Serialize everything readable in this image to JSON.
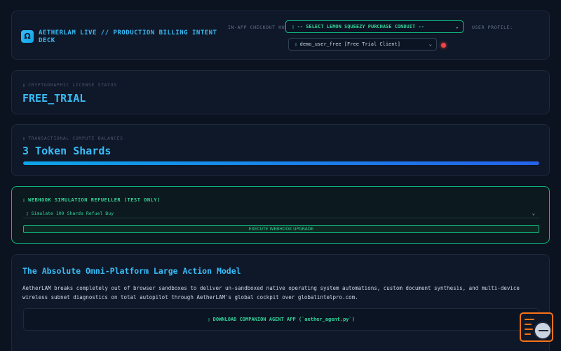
{
  "header": {
    "logo_letter": "Ω",
    "title": "AETHERLAM LIVE // PRODUCTION BILLING INTENT DECK",
    "hub_label": "IN-APP CHECKOUT HUB:",
    "hub_select": "-- SELECT LEMON SQUEEZY PURCHASE CONDUIT --",
    "profile_label": "USER PROFILE:",
    "user_select": "demo_user_free [Free Trial Client]"
  },
  "license": {
    "label": "CRYPTOGRAPHIC LICENSE STATUS",
    "value": "FREE_TRIAL"
  },
  "balance": {
    "label": "TRANSACTIONAL COMPUTE BALANCES",
    "value": "3 Token Shards",
    "progress_percent": 100
  },
  "webhook": {
    "title": "WEBHOOK SIMULATION REFUELLER (TEST ONLY)",
    "select_value": "Simulate 100 Shards Refuel Buy",
    "button_label": "EXECUTE WEBHOOK UPGRADE"
  },
  "hero": {
    "title": "The Absolute Omni-Platform Large Action Model",
    "description": "AetherLAM breaks completely out of browser sandboxes to deliver un-sandboxed native operating system automations, custom document synthesis, and multi-device wireless subnet diagnostics on total autopilot through AetherLAM's global cockpit over globalintelpro.com.",
    "download_label": "DOWNLOAD COMPANION AGENT APP (`aether_agent.py`)"
  },
  "colors": {
    "accent": "#38bdf8",
    "success": "#34d399",
    "danger": "#ef4444",
    "widget": "#f97316"
  },
  "icons": {
    "status_dot": "status-dot-icon",
    "chevron": "chevron-down-icon",
    "widget": "chat-widget-icon"
  }
}
